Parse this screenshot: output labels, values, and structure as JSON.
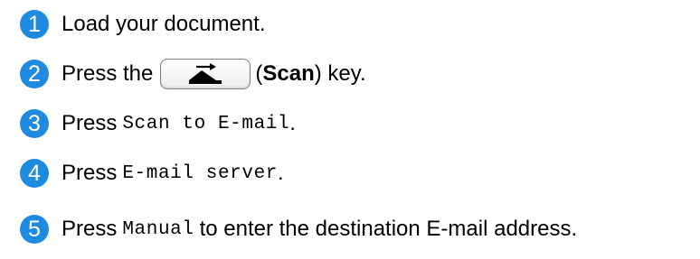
{
  "accent_color": "#1e8ae0",
  "steps": [
    {
      "number": "1",
      "text": "Load your document."
    },
    {
      "number": "2",
      "prefix": "Press the",
      "key_icon": "scan-icon",
      "paren_open": "(",
      "key_name": "Scan",
      "suffix": ") key."
    },
    {
      "number": "3",
      "prefix": "Press",
      "code": "Scan to E-mail",
      "suffix": "."
    },
    {
      "number": "4",
      "prefix": "Press",
      "code": "E-mail server",
      "suffix": "."
    },
    {
      "number": "5",
      "prefix": "Press",
      "code": "Manual",
      "suffix": "to enter the destination E-mail address."
    }
  ]
}
